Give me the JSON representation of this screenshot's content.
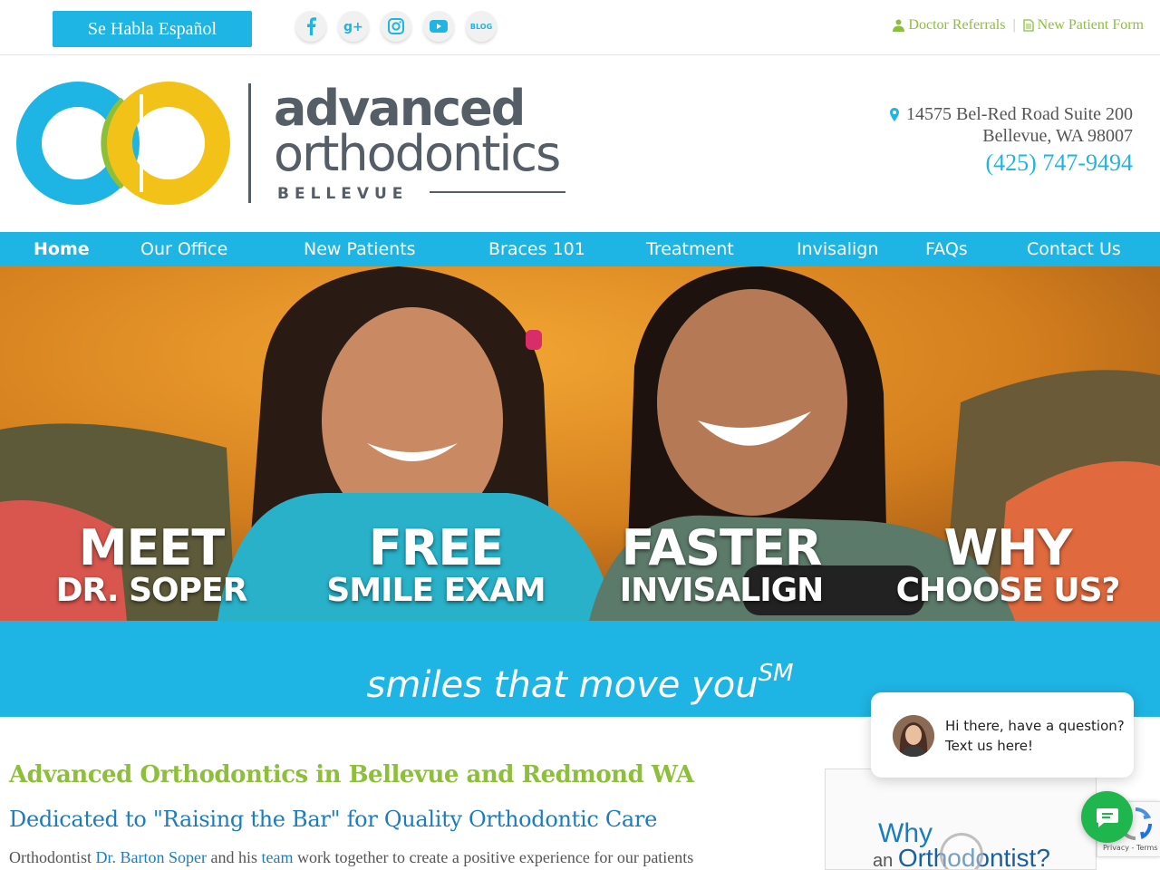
{
  "topbar": {
    "spanish_label": "Se Habla Español",
    "social": [
      {
        "icon": "facebook-icon"
      },
      {
        "icon": "google-plus-icon"
      },
      {
        "icon": "instagram-icon"
      },
      {
        "icon": "youtube-icon"
      },
      {
        "icon": "blog-icon",
        "label": "BLOG"
      }
    ],
    "doctor_referrals": "Doctor Referrals",
    "separator": "|",
    "new_patient_form": "New Patient Form"
  },
  "brand": {
    "name_line1": "advanced",
    "name_line2": "orthodontics",
    "location": "BELLEVUE",
    "colors": {
      "blue": "#1eb4e3",
      "green": "#8dbf3a",
      "yellow": "#f2c218",
      "gray": "#555d67"
    }
  },
  "contact": {
    "address_line1": "14575 Bel-Red Road Suite 200",
    "address_line2": "Bellevue, WA 98007",
    "phone": "(425) 747-9494"
  },
  "nav": {
    "items": [
      {
        "label": "Home",
        "active": true
      },
      {
        "label": "Our Office"
      },
      {
        "label": "New Patients"
      },
      {
        "label": "Braces 101"
      },
      {
        "label": "Treatment"
      },
      {
        "label": "Invisalign"
      },
      {
        "label": "FAQs"
      },
      {
        "label": "Contact Us"
      }
    ]
  },
  "hero": {
    "ctas": [
      {
        "line1": "MEET",
        "line2": "DR. SOPER"
      },
      {
        "line1": "FREE",
        "line2": "SMILE EXAM"
      },
      {
        "line1": "FASTER",
        "line2": "INVISALIGN"
      },
      {
        "line1": "WHY",
        "line2": "CHOOSE US?"
      }
    ]
  },
  "tagline": {
    "text": "smiles that move you",
    "mark": "SM"
  },
  "content": {
    "heading": "Advanced Orthodontics in Bellevue and Redmond WA",
    "subheading": "Dedicated to \"Raising the Bar\" for Quality Orthodontic Care",
    "para_prefix": "Orthodontist ",
    "para_link1": "Dr. Barton Soper",
    "para_mid": " and his ",
    "para_link2": "team",
    "para_suffix": " work together to create a positive experience for our patients"
  },
  "video": {
    "why": "Why",
    "an": "an ",
    "orthodontist": "Orthodontist?"
  },
  "chat": {
    "message": "Hi there, have a question? Text us here!"
  },
  "recaptcha": {
    "text": "Privacy - Terms"
  }
}
